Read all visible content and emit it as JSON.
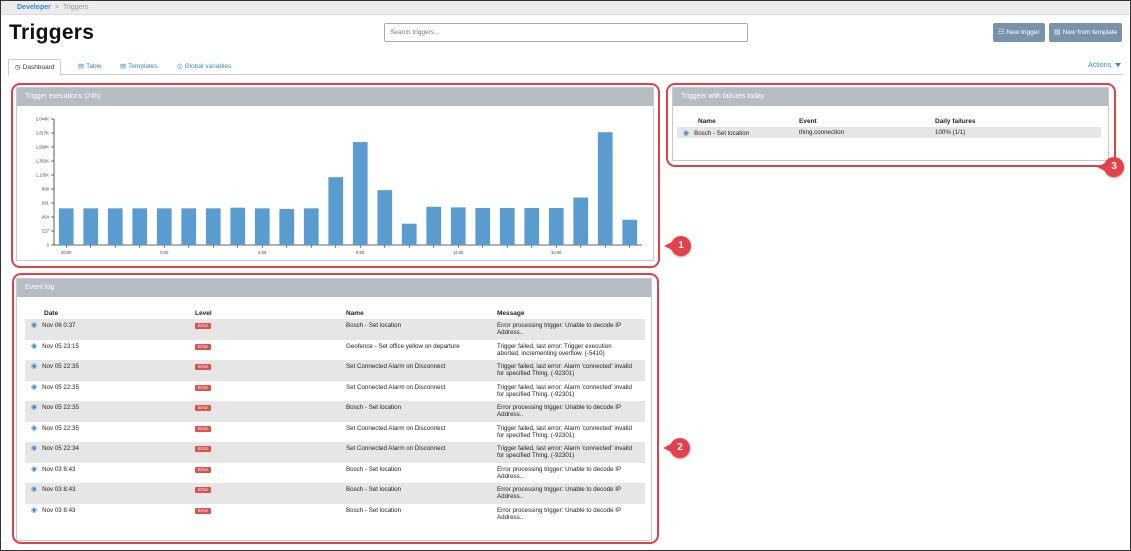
{
  "breadcrumb": {
    "parent": "Developer",
    "separator": ">",
    "current": "Triggers"
  },
  "page_title": "Triggers",
  "search": {
    "placeholder": "Search triggers..."
  },
  "buttons": {
    "new_trigger": "New trigger",
    "new_from_template": "New from template"
  },
  "tabs": [
    {
      "label": "Dashboard",
      "icon": "dashboard-icon"
    },
    {
      "label": "Table",
      "icon": "table-icon"
    },
    {
      "label": "Templates",
      "icon": "template-icon"
    },
    {
      "label": "Global variables",
      "icon": "globe-icon"
    }
  ],
  "actions_label": "Actions",
  "executions_panel": {
    "title": "Trigger executions (24h)"
  },
  "chart_data": {
    "type": "bar",
    "color": "#5a9bd0",
    "y_tick_labels": [
      "0",
      "227",
      "454",
      "681",
      "908",
      "1,135K",
      "1,362K",
      "1,589K",
      "1,817K",
      "2,044K"
    ],
    "ylim": [
      0,
      2044
    ],
    "x_tick_labels": [
      "20:00",
      "0:00",
      "4:00",
      "8:00",
      "12:00",
      "16:00"
    ],
    "x_tick_positions": [
      0,
      4,
      8,
      12,
      16,
      20
    ],
    "values": [
      595,
      595,
      595,
      595,
      595,
      595,
      595,
      605,
      595,
      585,
      595,
      1100,
      1670,
      890,
      345,
      620,
      610,
      600,
      600,
      600,
      600,
      770,
      1830,
      410
    ]
  },
  "failures_panel": {
    "title": "Triggers with failures today",
    "columns": [
      "Name",
      "Event",
      "Daily failures"
    ],
    "rows": [
      {
        "name": "Bosch - Set location",
        "event": "thing.connection",
        "failures": "100% (1/1)"
      }
    ]
  },
  "event_log": {
    "title": "Event log",
    "columns": [
      "Date",
      "Level",
      "Name",
      "Message"
    ],
    "rows": [
      {
        "date": "Nov 06 0:37",
        "level": "Error",
        "name": "Bosch - Set location",
        "message": "Error processing trigger: Unable to decode IP Address.."
      },
      {
        "date": "Nov 05 23:15",
        "level": "Error",
        "name": "Geofence - Set office yellow on departure",
        "message": "Trigger failed, last error: Trigger execution aborted, incrementing overflow. (-5410)"
      },
      {
        "date": "Nov 05 22:35",
        "level": "Error",
        "name": "Set Connected Alarm on Disconnect",
        "message": "Trigger failed, last error: Alarm 'connected' invalid for specified Thing. (-92301)"
      },
      {
        "date": "Nov 05 22:35",
        "level": "Error",
        "name": "Set Connected Alarm on Disconnect",
        "message": "Trigger failed, last error: Alarm 'connected' invalid for specified Thing. (-92301)"
      },
      {
        "date": "Nov 05 22:35",
        "level": "Error",
        "name": "Bosch - Set location",
        "message": "Error processing trigger: Unable to decode IP Address.."
      },
      {
        "date": "Nov 05 22:35",
        "level": "Error",
        "name": "Set Connected Alarm on Disconnect",
        "message": "Trigger failed, last error: Alarm 'connected' invalid for specified Thing. (-92301)"
      },
      {
        "date": "Nov 05 22:34",
        "level": "Error",
        "name": "Set Connected Alarm on Disconnect",
        "message": "Trigger failed, last error: Alarm 'connected' invalid for specified Thing. (-92301)"
      },
      {
        "date": "Nov 03 8:43",
        "level": "Error",
        "name": "Bosch - Set location",
        "message": "Error processing trigger: Unable to decode IP Address.."
      },
      {
        "date": "Nov 03 8:43",
        "level": "Error",
        "name": "Bosch - Set location",
        "message": "Error processing trigger: Unable to decode IP Address.."
      },
      {
        "date": "Nov 03 8:43",
        "level": "Error",
        "name": "Bosch - Set location",
        "message": "Error processing trigger: Unable to decode IP Address.."
      }
    ]
  },
  "annotations": [
    "1",
    "2",
    "3"
  ]
}
